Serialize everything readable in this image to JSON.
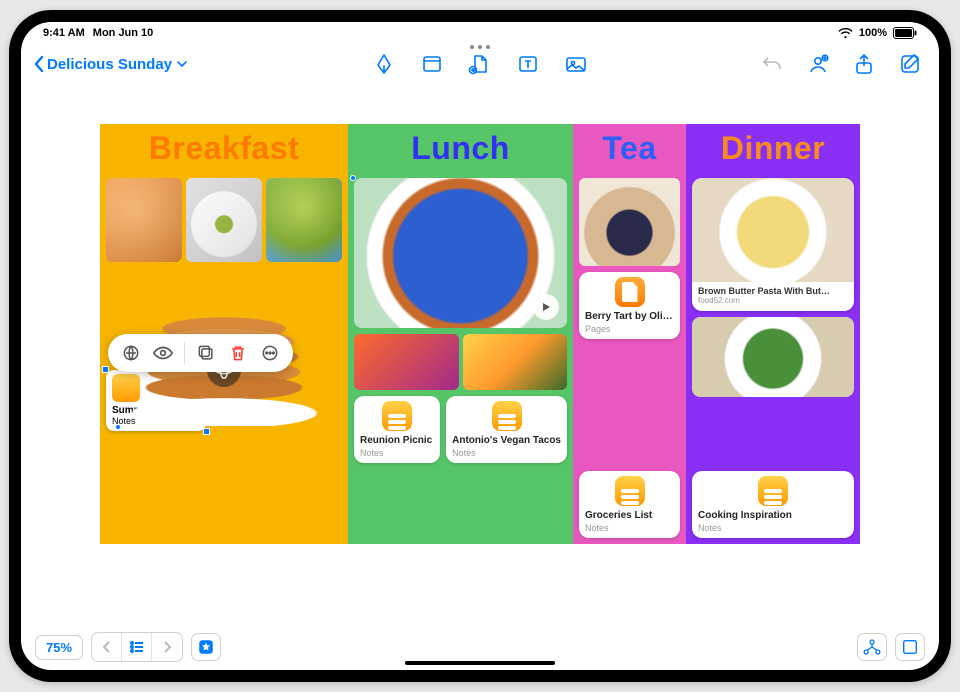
{
  "status": {
    "time": "9:41 AM",
    "date": "Mon Jun 10",
    "battery": "100%"
  },
  "toolbar": {
    "doc_title": "Delicious Sunday"
  },
  "zoom": {
    "level": "75%"
  },
  "columns": {
    "breakfast": {
      "header": "Breakfast"
    },
    "lunch": {
      "header": "Lunch"
    },
    "tea": {
      "header": "Tea"
    },
    "dinner": {
      "header": "Dinner"
    }
  },
  "cards": {
    "summer_party": {
      "title": "Summer Party",
      "sub": "Notes"
    },
    "reunion": {
      "title": "Reunion Picnic",
      "sub": "Notes"
    },
    "tacos_note": {
      "title": "Antonio's Vegan Tacos",
      "sub": "Notes"
    },
    "berry_tart": {
      "title": "Berry Tart by Olivia",
      "sub": "Pages"
    },
    "groceries": {
      "title": "Groceries List",
      "sub": "Notes"
    },
    "pasta_link": {
      "title": "Brown Butter Pasta With But…",
      "source": "food52.com"
    },
    "cooking": {
      "title": "Cooking Inspiration",
      "sub": "Notes"
    }
  },
  "colors": {
    "accent": "#007aff",
    "breakfast_bg": "#f7b500",
    "lunch_bg": "#56c568",
    "tea_bg": "#e858c0",
    "dinner_bg": "#8a2ff5"
  }
}
